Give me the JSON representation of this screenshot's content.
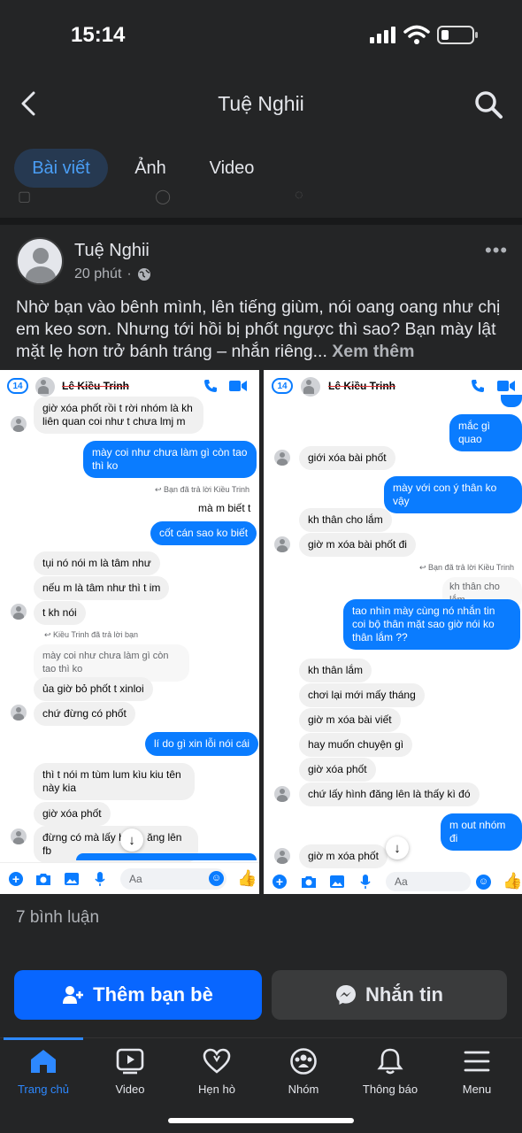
{
  "status": {
    "time": "15:14"
  },
  "header": {
    "title": "Tuệ Nghii"
  },
  "tabs": [
    {
      "label": "Bài viết"
    },
    {
      "label": "Ảnh"
    },
    {
      "label": "Video"
    }
  ],
  "post": {
    "author": "Tuệ Nghii",
    "time": "20 phút",
    "text": "Nhờ bạn vào bênh mình, lên tiếng giùm, nói oang oang như chị em keo sơn. Nhưng tới hồi bị phốt ngược thì sao? Bạn mày lật mặt lẹ hơn trở bánh tráng – nhắn riêng...",
    "see_more": "Xem thêm"
  },
  "left_chat": {
    "badge": "14",
    "name": "Lê Kiều Trinh",
    "messages": [
      {
        "t": "giờ xóa phốt rồi t rời nhóm là kh liên quan coi như t chưa lmj m"
      },
      {
        "t": "mày coi như chưa làm gì còn tao thì ko"
      },
      {
        "t": "Bạn đã trả lời Kiều Trinh"
      },
      {
        "t": "mà m biết t"
      },
      {
        "t": "cốt cán sao ko biết"
      },
      {
        "t": "tụi nó nói m là tâm như"
      },
      {
        "t": "nếu m là tâm như thì t im"
      },
      {
        "t": "t kh nói"
      },
      {
        "t": "Kiều Trinh đã trả lời bạn"
      },
      {
        "t": "mày coi như chưa làm gì còn tao thì ko"
      },
      {
        "t": "ủa giờ bỏ phốt t xinloi"
      },
      {
        "t": "chứ đừng có phốt"
      },
      {
        "t": "lí do gì xin lỗi nói cái"
      },
      {
        "t": "thì t nói m tùm lum kìu kiu tên này kia"
      },
      {
        "t": "giờ xóa phốt"
      },
      {
        "t": "đừng có mà lấy h"
      },
      {
        "t": "ăng lên fb"
      }
    ],
    "composer": "Aa"
  },
  "right_chat": {
    "badge": "14",
    "name": "Lê Kiều Trinh",
    "messages": [
      {
        "t": "mắc gì quao"
      },
      {
        "t": "giới xóa bài phốt"
      },
      {
        "t": "mày với con ý thân ko vậy"
      },
      {
        "t": "kh thân cho lắm"
      },
      {
        "t": "giờ m xóa bài phốt đi"
      },
      {
        "t": "Bạn đã trả lời Kiều Trinh"
      },
      {
        "t": "kh thân cho lắm"
      },
      {
        "t": "tao nhìn mày cùng nó nhắn tin coi bộ thân mặt sao giờ nói ko thân lắm ??"
      },
      {
        "t": "kh thân lắm"
      },
      {
        "t": "chơi lại mới mấy tháng"
      },
      {
        "t": "giờ m xóa bài viết"
      },
      {
        "t": "hay muốn chuyện gì"
      },
      {
        "t": "giờ xóa phốt"
      },
      {
        "t": "chứ lấy hình đăng lên là thấy kì đó"
      },
      {
        "t": "m out nhóm đi"
      },
      {
        "t": "giờ m xóa phốt"
      }
    ],
    "composer": "Aa"
  },
  "comments": "7 bình luận",
  "actions": {
    "add_friend": "Thêm bạn bè",
    "message": "Nhắn tin"
  },
  "nav": [
    {
      "label": "Trang chủ"
    },
    {
      "label": "Video"
    },
    {
      "label": "Hẹn hò"
    },
    {
      "label": "Nhóm"
    },
    {
      "label": "Thông báo"
    },
    {
      "label": "Menu"
    }
  ],
  "colors": {
    "accent": "#0866ff",
    "bubble_out": "#0a7cff",
    "bg": "#242526"
  }
}
